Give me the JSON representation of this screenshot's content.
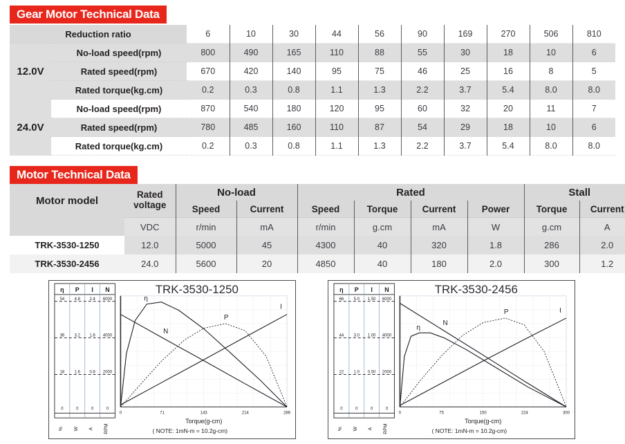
{
  "gear_section": {
    "banner": "Gear Motor Technical Data",
    "ratio_label": "Reduction ratio",
    "ratios": [
      "6",
      "10",
      "30",
      "44",
      "56",
      "90",
      "169",
      "270",
      "506",
      "810"
    ],
    "voltage_blocks": [
      {
        "voltage": "12.0V",
        "rows": [
          {
            "label": "No-load speed(rpm)",
            "values": [
              "800",
              "490",
              "165",
              "110",
              "88",
              "55",
              "30",
              "18",
              "10",
              "6"
            ]
          },
          {
            "label": "Rated speed(rpm)",
            "values": [
              "670",
              "420",
              "140",
              "95",
              "75",
              "46",
              "25",
              "16",
              "8",
              "5"
            ]
          },
          {
            "label": "Rated torque(kg.cm)",
            "values": [
              "0.2",
              "0.3",
              "0.8",
              "1.1",
              "1.3",
              "2.2",
              "3.7",
              "5.4",
              "8.0",
              "8.0"
            ]
          }
        ]
      },
      {
        "voltage": "24.0V",
        "rows": [
          {
            "label": "No-load speed(rpm)",
            "values": [
              "870",
              "540",
              "180",
              "120",
              "95",
              "60",
              "32",
              "20",
              "11",
              "7"
            ]
          },
          {
            "label": "Rated speed(rpm)",
            "values": [
              "780",
              "485",
              "160",
              "110",
              "87",
              "54",
              "29",
              "18",
              "10",
              "6"
            ]
          },
          {
            "label": "Rated torque(kg.cm)",
            "values": [
              "0.2",
              "0.3",
              "0.8",
              "1.1",
              "1.3",
              "2.2",
              "3.7",
              "5.4",
              "8.0",
              "8.0"
            ]
          }
        ]
      }
    ]
  },
  "motor_section": {
    "banner": "Motor Technical Data",
    "model_header": "Motor model",
    "rated_voltage_header": "Rated voltage",
    "groups": [
      {
        "name": "No-load",
        "cols": [
          "Speed",
          "Current"
        ]
      },
      {
        "name": "Rated",
        "cols": [
          "Speed",
          "Torque",
          "Current",
          "Power"
        ]
      },
      {
        "name": "Stall",
        "cols": [
          "Torque",
          "Current"
        ]
      }
    ],
    "units": [
      "VDC",
      "r/min",
      "mA",
      "r/min",
      "g.cm",
      "mA",
      "W",
      "g.cm",
      "A"
    ],
    "rows": [
      {
        "model": "TRK-3530-1250",
        "values": [
          "12.0",
          "5000",
          "45",
          "4300",
          "40",
          "320",
          "1.8",
          "286",
          "2.0"
        ]
      },
      {
        "model": "TRK-3530-2456",
        "values": [
          "24.0",
          "5600",
          "20",
          "4850",
          "40",
          "180",
          "2.0",
          "300",
          "1.2"
        ]
      }
    ]
  },
  "charts": [
    {
      "title": "TRK-3530-1250",
      "xlabel": "Torque(g-cm)",
      "note": "( NOTE: 1mN-m = 10.2g-cm)",
      "scale_headers": [
        "η",
        "P",
        "I",
        "N"
      ],
      "scale_units": [
        "%",
        "W",
        "A",
        "RPM"
      ],
      "scales": [
        {
          "symbol": "η",
          "unit": "%",
          "ticks": [
            "0",
            "18",
            "36",
            "54"
          ]
        },
        {
          "symbol": "P",
          "unit": "W",
          "ticks": [
            "0",
            "1.6",
            "3.2",
            "4.8"
          ]
        },
        {
          "symbol": "I",
          "unit": "A",
          "ticks": [
            "0",
            "0.8",
            "1.6",
            "2.4"
          ]
        },
        {
          "symbol": "N",
          "unit": "RPM",
          "ticks": [
            "0",
            "2000",
            "4000",
            "6000"
          ]
        }
      ],
      "xticks": [
        "0",
        "71",
        "143",
        "214",
        "286"
      ],
      "curve_labels": [
        "η",
        "N",
        "P",
        "I"
      ],
      "chart_data": {
        "type": "line",
        "title": "TRK-3530-1250",
        "xlabel": "Torque(g-cm)",
        "ylabel": "",
        "xlim": [
          0,
          286
        ],
        "grid": true,
        "legend": "inline-labels",
        "series": [
          {
            "name": "η",
            "unit": "%",
            "ymax": 54,
            "x": [
              0,
              10,
              25,
              45,
              70,
              100,
              143,
              190,
              240,
              286
            ],
            "y": [
              0,
              26,
              42,
              50,
              51,
              47,
              38,
              26,
              13,
              0
            ]
          },
          {
            "name": "N",
            "unit": "RPM",
            "ymax": 6000,
            "x": [
              0,
              71,
              143,
              214,
              286
            ],
            "y": [
              5000,
              3750,
              2500,
              1250,
              0
            ]
          },
          {
            "name": "P",
            "unit": "W",
            "ymax": 4.8,
            "x": [
              0,
              35,
              71,
              110,
              143,
              180,
              214,
              250,
              286
            ],
            "y": [
              0,
              1.0,
              2.0,
              2.9,
              3.4,
              3.6,
              3.3,
              2.2,
              0
            ]
          },
          {
            "name": "I",
            "unit": "A",
            "ymax": 2.4,
            "x": [
              0,
              71,
              143,
              214,
              286
            ],
            "y": [
              0.045,
              0.53,
              1.02,
              1.51,
              2.0
            ]
          }
        ]
      }
    },
    {
      "title": "TRK-3530-2456",
      "xlabel": "Torque(g-cm)",
      "note": "( NOTE: 1mN-m = 10.2g-cm)",
      "scale_headers": [
        "η",
        "P",
        "I",
        "N"
      ],
      "scale_units": [
        "%",
        "W",
        "A",
        "RPM"
      ],
      "scales": [
        {
          "symbol": "η",
          "unit": "%",
          "ticks": [
            "0",
            "22",
            "44",
            "66"
          ]
        },
        {
          "symbol": "P",
          "unit": "W",
          "ticks": [
            "0",
            "1.0",
            "3.0",
            "5.0"
          ]
        },
        {
          "symbol": "I",
          "unit": "A",
          "ticks": [
            "0",
            "0.50",
            "1.00",
            "1.50"
          ]
        },
        {
          "symbol": "N",
          "unit": "RPM",
          "ticks": [
            "0",
            "2000",
            "4000",
            "6000"
          ]
        }
      ],
      "xticks": [
        "0",
        "75",
        "150",
        "224",
        "300"
      ],
      "curve_labels": [
        "η",
        "N",
        "P",
        "I"
      ],
      "chart_data": {
        "type": "line",
        "title": "TRK-3530-2456",
        "xlabel": "Torque(g-cm)",
        "ylabel": "",
        "xlim": [
          0,
          300
        ],
        "grid": true,
        "legend": "inline-labels",
        "series": [
          {
            "name": "η",
            "unit": "%",
            "ymax": 66,
            "x": [
              0,
              8,
              20,
              35,
              55,
              80,
              120,
              170,
              230,
              300
            ],
            "y": [
              0,
              30,
              42,
              44,
              44,
              41,
              34,
              24,
              12,
              0
            ]
          },
          {
            "name": "N",
            "unit": "RPM",
            "ymax": 6000,
            "x": [
              0,
              75,
              150,
              224,
              300
            ],
            "y": [
              5600,
              4200,
              2800,
              1400,
              0
            ]
          },
          {
            "name": "P",
            "unit": "W",
            "ymax": 5.0,
            "x": [
              0,
              37,
              75,
              112,
              150,
              190,
              224,
              260,
              300
            ],
            "y": [
              0,
              1.2,
              2.3,
              3.2,
              3.8,
              4.0,
              3.7,
              2.5,
              0
            ]
          },
          {
            "name": "I",
            "unit": "A",
            "ymax": 1.5,
            "x": [
              0,
              75,
              150,
              224,
              300
            ],
            "y": [
              0.02,
              0.32,
              0.62,
              0.91,
              1.2
            ]
          }
        ]
      }
    }
  ],
  "colors": {
    "banner_red": "#e8271c",
    "shade": "#dedede",
    "header_shade": "#d9d9d9",
    "text": "#231f20",
    "value_text": "#3a3a42",
    "rule": "#5b5b63"
  }
}
